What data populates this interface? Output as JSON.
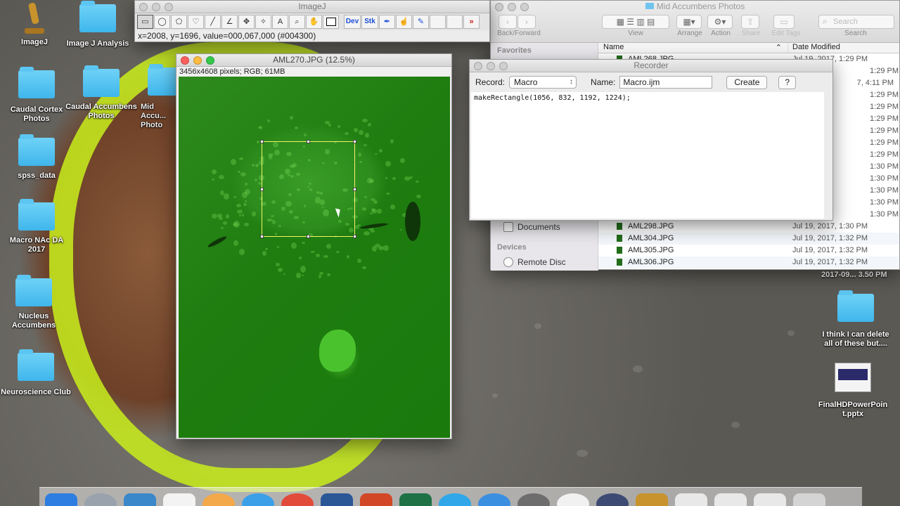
{
  "desktop": {
    "icons": [
      {
        "label": "ImageJ"
      },
      {
        "label": "Image J Analysis"
      },
      {
        "label": "Caudal Cortex Photos"
      },
      {
        "label": "Caudal Accumbens Photos"
      },
      {
        "label": "Mid Accu... Photo"
      },
      {
        "label": "spss_data"
      },
      {
        "label": "Macro NAc DA 2017"
      },
      {
        "label": "Nucleus Accumbens"
      },
      {
        "label": "Neuroscience Club"
      },
      {
        "label": "I think I can delete all of these but...."
      },
      {
        "label": "FinalHDPowerPoint.pptx"
      }
    ],
    "date_label": "2017-09... 3.50 PM"
  },
  "imagej": {
    "title": "ImageJ",
    "tools": [
      "rectangle-tool",
      "oval-tool",
      "polygon-tool",
      "freehand-tool",
      "line-tool",
      "angle-tool",
      "multipoint-tool",
      "wand-tool",
      "text-tool",
      "zoom-tool",
      "hand-tool",
      "color-picker-tool"
    ],
    "text_tools": [
      "Dev",
      "Stk"
    ],
    "status": "x=2008, y=1696, value=000,067,000 (#004300)"
  },
  "image_window": {
    "title": "AML270.JPG (12.5%)",
    "info": "3456x4608 pixels; RGB; 61MB"
  },
  "finder": {
    "title": "Mid Accumbens Photos",
    "toolbar": {
      "back_forward": "Back/Forward",
      "view": "View",
      "arrange": "Arrange",
      "action": "Action",
      "share": "Share",
      "edit_tags": "Edit Tags",
      "search_caption": "Search",
      "search_placeholder": "Search"
    },
    "sidebar": {
      "favorites_header": "Favorites",
      "documents": "Documents",
      "devices_header": "Devices",
      "remote_disc": "Remote Disc"
    },
    "columns": {
      "name": "Name",
      "date": "Date Modified"
    },
    "rows": [
      {
        "name": "AML268.JPG",
        "date": "Jul 19, 2017, 1:29 PM"
      },
      {
        "name": "",
        "date": "1:29 PM"
      },
      {
        "name": "",
        "date": "7, 4:11 PM"
      },
      {
        "name": "",
        "date": "1:29 PM"
      },
      {
        "name": "",
        "date": "1:29 PM"
      },
      {
        "name": "",
        "date": "1:29 PM"
      },
      {
        "name": "",
        "date": "1:29 PM"
      },
      {
        "name": "",
        "date": "1:29 PM"
      },
      {
        "name": "",
        "date": "1:29 PM"
      },
      {
        "name": "",
        "date": "1:30 PM"
      },
      {
        "name": "",
        "date": "1:30 PM"
      },
      {
        "name": "",
        "date": "1:30 PM"
      },
      {
        "name": "",
        "date": "1:30 PM"
      },
      {
        "name": "",
        "date": "1:30 PM"
      },
      {
        "name": "AML298.JPG",
        "date": "Jul 19, 2017, 1:30 PM"
      },
      {
        "name": "AML304.JPG",
        "date": "Jul 19, 2017, 1:32 PM"
      },
      {
        "name": "AML305.JPG",
        "date": "Jul 19, 2017, 1:32 PM"
      },
      {
        "name": "AML306.JPG",
        "date": "Jul 19, 2017, 1:32 PM"
      }
    ]
  },
  "recorder": {
    "title": "Recorder",
    "record_label": "Record:",
    "record_value": "Macro",
    "name_label": "Name:",
    "name_value": "Macro.ijm",
    "create_label": "Create",
    "help_label": "?",
    "code": "makeRectangle(1056, 832, 1192, 1224);"
  }
}
